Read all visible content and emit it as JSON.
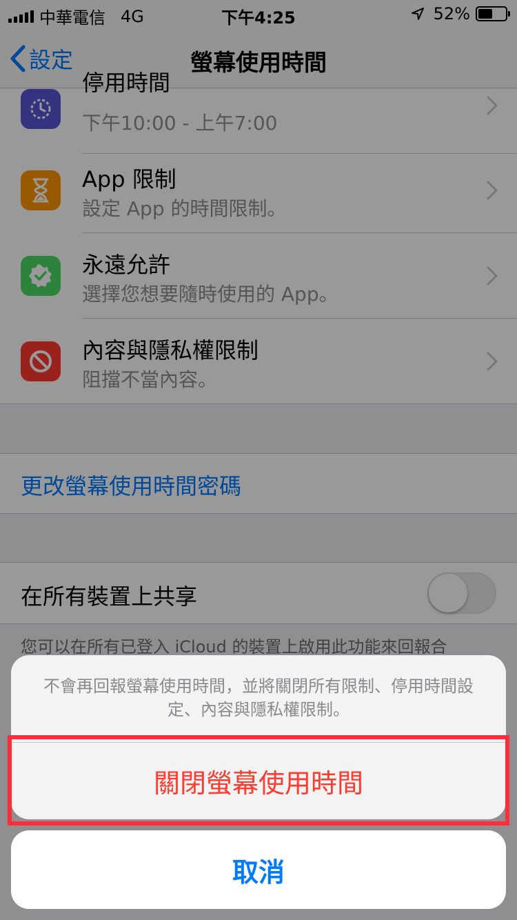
{
  "status_bar": {
    "carrier": "中華電信",
    "network": "4G",
    "time": "下午4:25",
    "battery": "52%",
    "battery_level": 0.52
  },
  "nav": {
    "back_label": "設定",
    "title": "螢幕使用時間"
  },
  "rows": [
    {
      "title": "停用時間",
      "subtitle": "下午10:00 - 上午7:00",
      "icon": "downtime-icon",
      "color": "#5856d6"
    },
    {
      "title": "App 限制",
      "subtitle": "設定 App 的時間限制。",
      "icon": "hourglass-icon",
      "color": "#ff9500"
    },
    {
      "title": "永遠允許",
      "subtitle": "選擇您想要隨時使用的 App。",
      "icon": "checkmark-badge-icon",
      "color": "#4cd964"
    },
    {
      "title": "內容與隱私權限制",
      "subtitle": "阻擋不當內容。",
      "icon": "prohibited-icon",
      "color": "#ff3b30"
    }
  ],
  "change_passcode": "更改螢幕使用時間密碼",
  "share": {
    "label": "在所有裝置上共享",
    "enabled": false,
    "footer": "您可以在所有已登入 iCloud 的裝置上啟用此功能來回報合"
  },
  "action_sheet": {
    "message": "不會再回報螢幕使用時間，並將關閉所有限制、停用時間設定、內容與隱私權限制。",
    "destructive_label": "關閉螢幕使用時間",
    "cancel_label": "取消"
  }
}
